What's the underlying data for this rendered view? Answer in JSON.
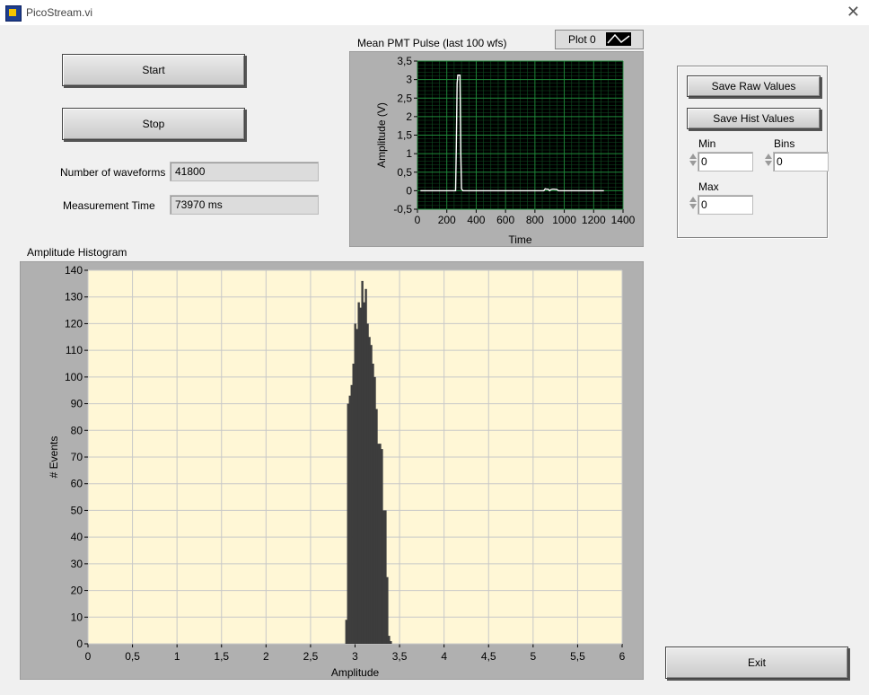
{
  "window": {
    "title": "PicoStream.vi",
    "icon": "labview-vi-icon",
    "close_glyph": "✕"
  },
  "controls": {
    "start_label": "Start",
    "stop_label": "Stop",
    "exit_label": "Exit",
    "save_raw_label": "Save Raw Values",
    "save_hist_label": "Save Hist Values"
  },
  "indicators": {
    "waveforms_label": "Number of waveforms",
    "waveforms_value": "41800",
    "time_label": "Measurement Time",
    "time_value": "73970 ms"
  },
  "hist_settings": {
    "min_label": "Min",
    "min_value": "0",
    "bins_label": "Bins",
    "bins_value": "0",
    "max_label": "Max",
    "max_value": "0"
  },
  "colors": {
    "pulse_plot_bg": "#000000",
    "pulse_grid": "#1f8a3a",
    "pulse_trace": "#ffffff",
    "hist_plot_bg": "#fff7d6",
    "hist_grid": "#c8c8c8",
    "hist_bars": "#3d3d3d",
    "frame": "#b0b0b0"
  },
  "chart_data": [
    {
      "id": "pulse",
      "type": "line",
      "title": "Mean PMT Pulse (last 100 wfs)",
      "legend": {
        "entries": [
          "Plot 0"
        ],
        "placement": "top-right"
      },
      "xlabel": "Time",
      "ylabel": "Amplitude (V)",
      "xlim": [
        0,
        1400
      ],
      "ylim": [
        -0.5,
        3.5
      ],
      "xticks": [
        0,
        200,
        400,
        600,
        800,
        1000,
        1200,
        1400
      ],
      "xtick_labels": [
        "0",
        "200",
        "400",
        "600",
        "800",
        "1000",
        "1200",
        "1400"
      ],
      "yticks": [
        -0.5,
        0,
        0.5,
        1,
        1.5,
        2,
        2.5,
        3,
        3.5
      ],
      "ytick_labels": [
        "-0,5",
        "0",
        "0,5",
        "1",
        "1,5",
        "2",
        "2,5",
        "3",
        "3,5"
      ],
      "grid": true,
      "series": [
        {
          "x": [
            20,
            260,
            265,
            270,
            275,
            290,
            295,
            300,
            310,
            860,
            870,
            880,
            890,
            900,
            910,
            920,
            930,
            950,
            960,
            1270
          ],
          "y": [
            0,
            0,
            1.2,
            2.9,
            3.12,
            3.12,
            1.0,
            0.05,
            0,
            0,
            0.05,
            0.04,
            0.04,
            0,
            0.03,
            0.04,
            0.04,
            0.03,
            0,
            0
          ]
        }
      ]
    },
    {
      "id": "histogram",
      "type": "bar",
      "title": "Amplitude Histogram",
      "xlabel": "Amplitude",
      "ylabel": "# Events",
      "xlim": [
        0,
        6
      ],
      "ylim": [
        0,
        140
      ],
      "xticks": [
        0,
        0.5,
        1,
        1.5,
        2,
        2.5,
        3,
        3.5,
        4,
        4.5,
        5,
        5.5,
        6
      ],
      "xtick_labels": [
        "0",
        "0,5",
        "1",
        "1,5",
        "2",
        "2,5",
        "3",
        "3,5",
        "4",
        "4,5",
        "5",
        "5,5",
        "6"
      ],
      "yticks": [
        0,
        10,
        20,
        30,
        40,
        50,
        60,
        70,
        80,
        90,
        100,
        110,
        120,
        130,
        140
      ],
      "ytick_labels": [
        "0",
        "10",
        "20",
        "30",
        "40",
        "50",
        "60",
        "70",
        "80",
        "90",
        "100",
        "110",
        "120",
        "130",
        "140"
      ],
      "grid": true,
      "bin_start": 2.89,
      "bin_width": 0.02,
      "values": [
        9,
        90,
        93,
        97,
        105,
        120,
        118,
        128,
        126,
        136,
        128,
        133,
        120,
        115,
        112,
        105,
        100,
        88,
        75,
        75,
        73,
        50,
        50,
        25,
        3,
        1
      ]
    }
  ]
}
